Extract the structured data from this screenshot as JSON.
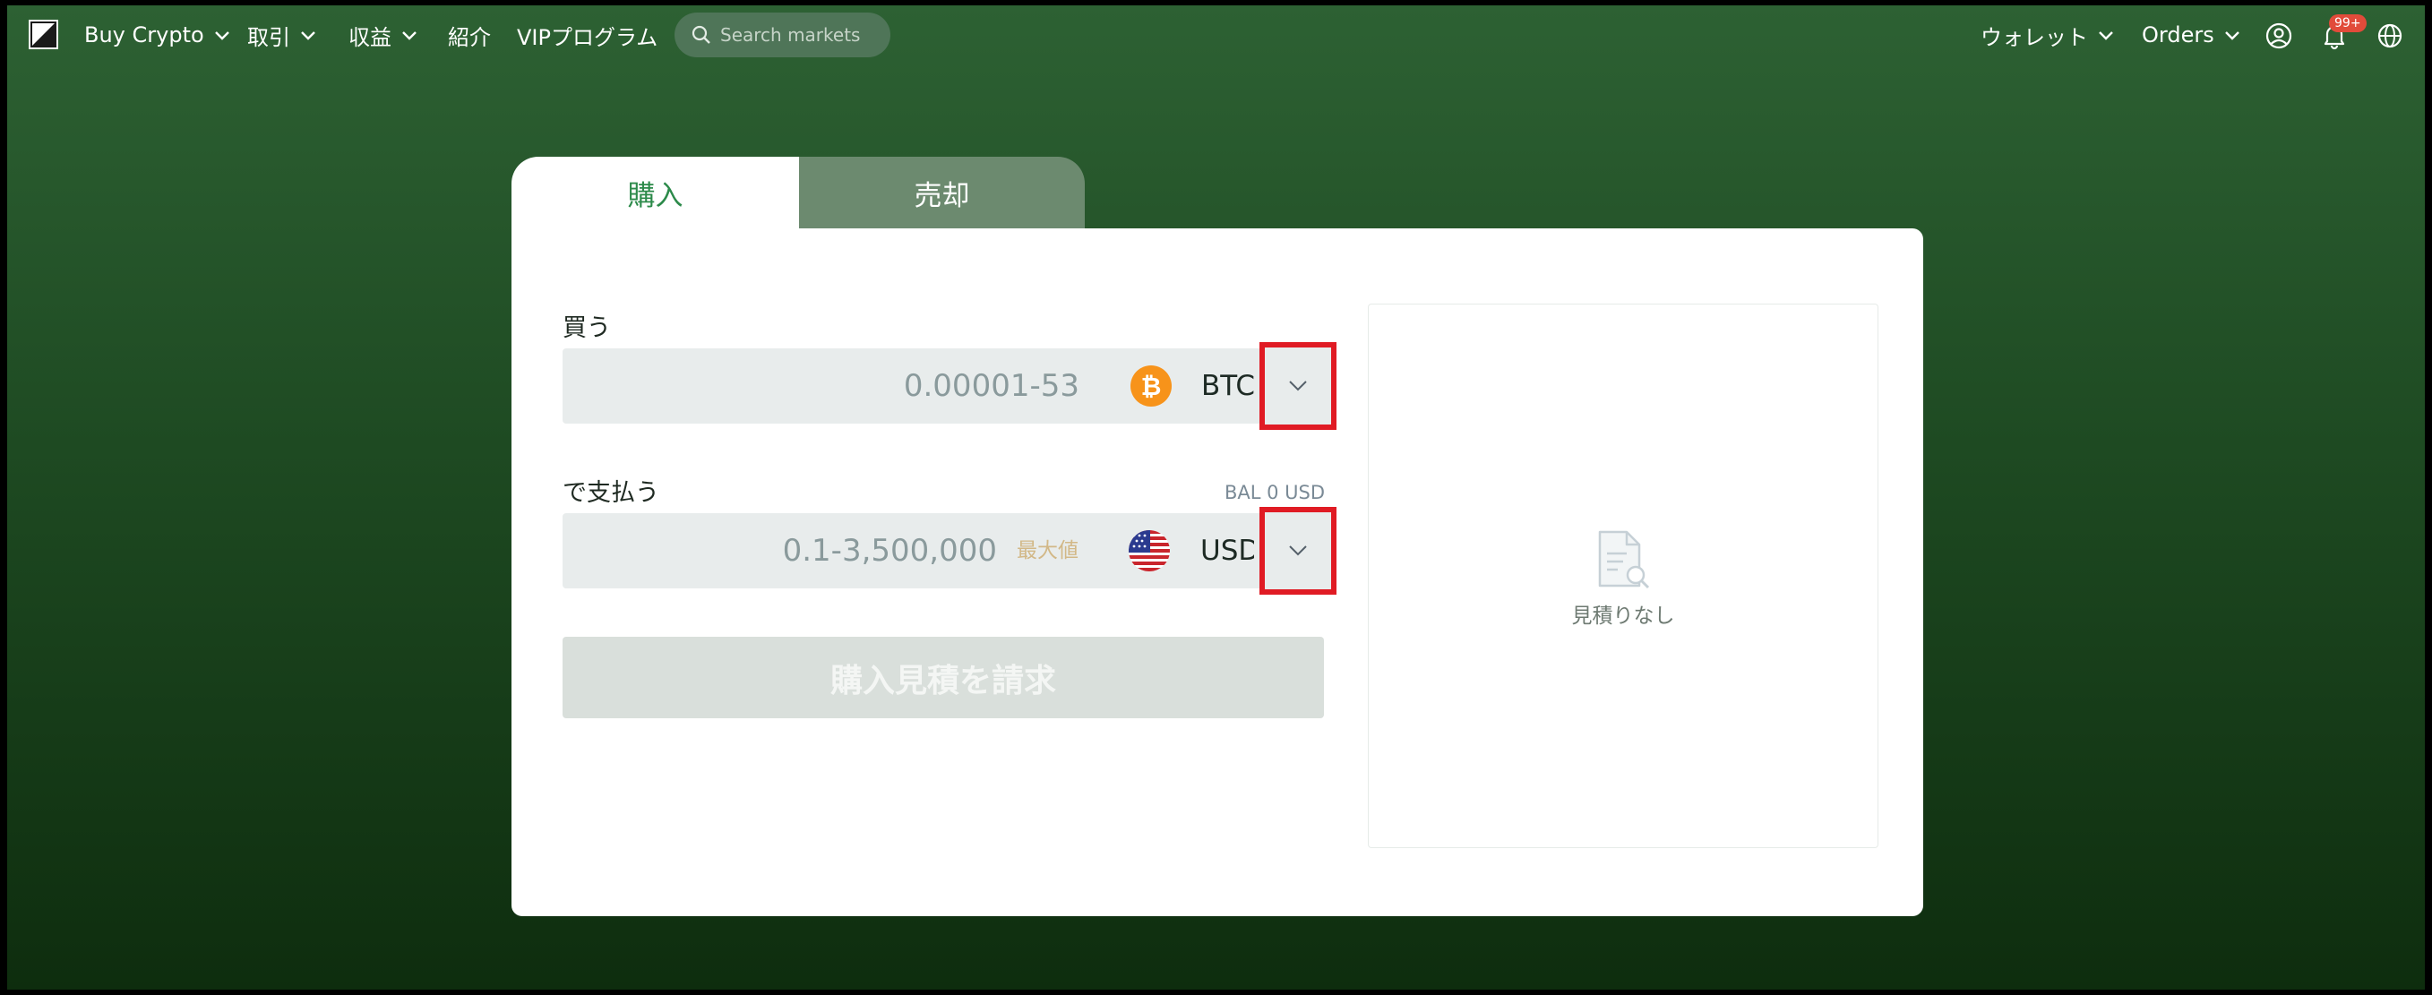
{
  "nav": {
    "buy_crypto": "Buy Crypto",
    "trade": "取引",
    "earn": "収益",
    "referral": "紹介",
    "vip": "VIPプログラム",
    "search_placeholder": "Search markets",
    "wallet": "ウォレット",
    "orders": "Orders",
    "notification_badge": "99+"
  },
  "tabs": {
    "buy": "購入",
    "sell": "売却"
  },
  "form": {
    "buy_label": "買う",
    "buy_range": "0.00001-53",
    "buy_currency": "BTC",
    "pay_label": "で支払う",
    "balance": "BAL 0 USD",
    "pay_range": "0.1-3,500,000",
    "max_label": "最大値",
    "pay_currency": "USD",
    "submit_label": "購入見積を請求"
  },
  "quote": {
    "empty_text": "見積りなし"
  },
  "colors": {
    "accent_green": "#2c8a4a",
    "bitcoin_orange": "#f7931a",
    "highlight_red": "#e01b24",
    "max_gold": "#d2b887"
  },
  "icons": {
    "search": "search-icon",
    "account": "user-circle-icon",
    "notifications": "bell-icon",
    "language": "globe-icon",
    "dropdown": "chevron-down-icon",
    "quote_empty": "document-search-icon"
  }
}
